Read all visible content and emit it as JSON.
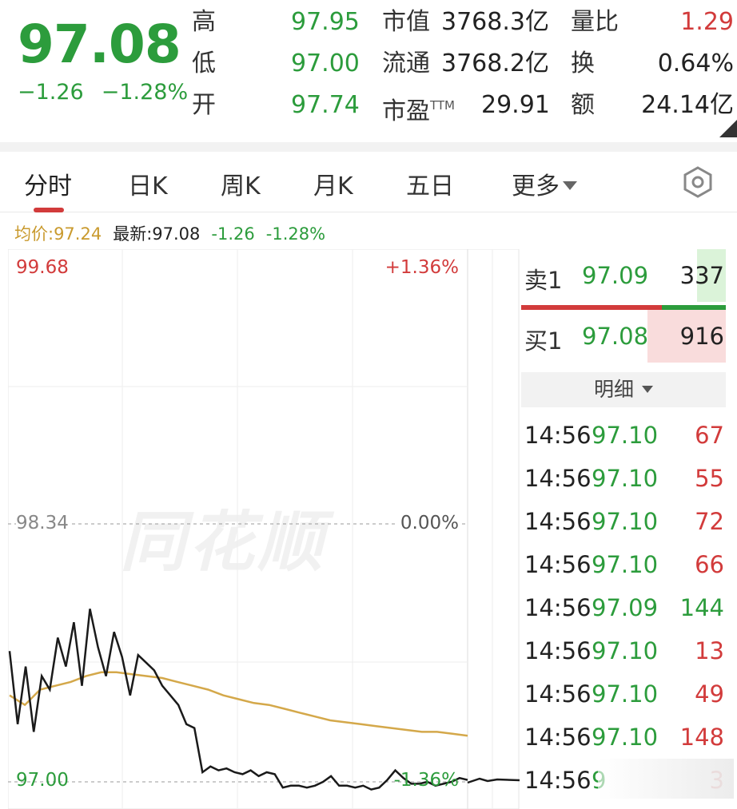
{
  "quote": {
    "price": "97.08",
    "change": "−1.26",
    "change_pct": "−1.28%",
    "high_label": "高",
    "high": "97.95",
    "low_label": "低",
    "low": "97.00",
    "open_label": "开",
    "open": "97.74",
    "mktcap_label": "市值",
    "mktcap": "3768.3亿",
    "float_label": "流通",
    "float": "3768.2亿",
    "pe_label": "市盈",
    "pe_sup": "TTM",
    "pe": "29.91",
    "volratio_label": "量比",
    "volratio": "1.29",
    "turnover_label": "换",
    "turnover": "0.64%",
    "amount_label": "额",
    "amount": "24.14亿"
  },
  "tabs": [
    {
      "label": "分时",
      "active": true
    },
    {
      "label": "日K"
    },
    {
      "label": "周K"
    },
    {
      "label": "月K"
    },
    {
      "label": "五日"
    },
    {
      "label": "更多"
    }
  ],
  "settings_icon": "hexagon-settings-icon",
  "info_line": {
    "avg": "均价:97.24",
    "latest": "最新:97.08",
    "change": "-1.26",
    "change_pct": "-1.28%"
  },
  "chart": {
    "watermark": "同花顺",
    "y_top_label": "99.68",
    "y_mid_label": "98.34",
    "y_bottom_label": "97.00",
    "pct_top_label": "+1.36%",
    "pct_mid_label": "0.00%",
    "pct_bottom_label": "-1.36%"
  },
  "chart_data": {
    "type": "line",
    "title": "",
    "ylim": [
      97.0,
      99.68
    ],
    "prev_close": 98.34,
    "grid": true,
    "series": [
      {
        "values": [
          97.68,
          97.3,
          97.6,
          97.26,
          97.55,
          97.48,
          97.75,
          97.6,
          97.83,
          97.5,
          97.9,
          97.7,
          97.55,
          97.78,
          97.65,
          97.45,
          97.66,
          97.62,
          97.58,
          97.5,
          97.45,
          97.4,
          97.3,
          97.28,
          97.05,
          97.08,
          97.06,
          97.07,
          97.05,
          97.04,
          97.06,
          97.03,
          97.05,
          97.04,
          96.97,
          96.98,
          96.98,
          96.97,
          96.98,
          97.0,
          97.03,
          96.98,
          96.98,
          96.97,
          96.98,
          96.96,
          96.97,
          97.01,
          97.06,
          97.02,
          96.99,
          96.99,
          97.0,
          96.98,
          96.99,
          97.0,
          97.02,
          97.01
        ]
      },
      {
        "values": [
          97.45,
          97.4,
          97.48,
          97.5,
          97.52,
          97.55,
          97.57,
          97.57,
          97.56,
          97.55,
          97.54,
          97.52,
          97.5,
          97.48,
          97.45,
          97.43,
          97.41,
          97.4,
          97.38,
          97.36,
          97.34,
          97.32,
          97.31,
          97.3,
          97.29,
          97.28,
          97.27,
          97.26,
          97.26,
          97.25,
          97.24
        ]
      }
    ]
  },
  "book": {
    "sell": {
      "label": "卖1",
      "price": "97.09",
      "volume": "337"
    },
    "buy": {
      "label": "买1",
      "price": "97.08",
      "volume": "916"
    },
    "detail_label": "明细"
  },
  "trades": [
    {
      "time": "14:56",
      "price": "97.10",
      "volume": "67",
      "color": "red"
    },
    {
      "time": "14:56",
      "price": "97.10",
      "volume": "55",
      "color": "red"
    },
    {
      "time": "14:56",
      "price": "97.10",
      "volume": "72",
      "color": "red"
    },
    {
      "time": "14:56",
      "price": "97.10",
      "volume": "66",
      "color": "red"
    },
    {
      "time": "14:56",
      "price": "97.09",
      "volume": "144",
      "color": "green"
    },
    {
      "time": "14:56",
      "price": "97.10",
      "volume": "13",
      "color": "red"
    },
    {
      "time": "14:56",
      "price": "97.10",
      "volume": "49",
      "color": "red"
    },
    {
      "time": "14:56",
      "price": "97.10",
      "volume": "148",
      "color": "red"
    },
    {
      "time": "14:56",
      "price": "9",
      "volume": "3",
      "color": "red"
    }
  ],
  "colors": {
    "up_red": "#d23b3b",
    "down_green": "#2c9c3c",
    "avg_line": "#d4a84a",
    "price_line": "#1a1a1a"
  }
}
